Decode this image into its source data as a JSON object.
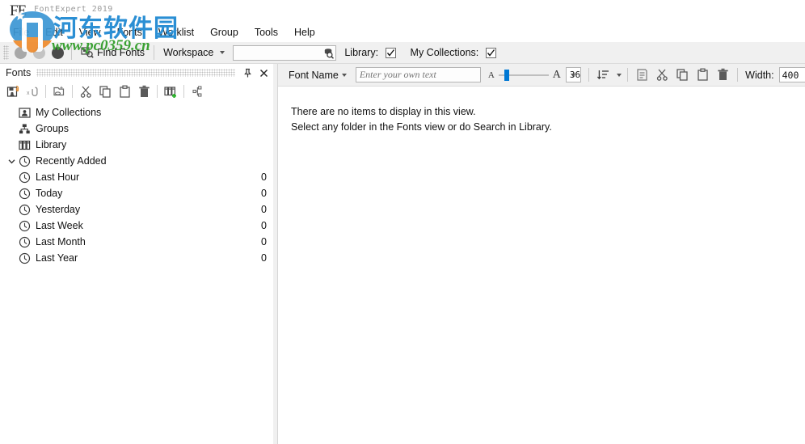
{
  "app": {
    "logo_text": "FE",
    "title": "FontExpert 2019"
  },
  "menubar": {
    "items": [
      {
        "label": "File"
      },
      {
        "label": "Edit"
      },
      {
        "label": "View"
      },
      {
        "label": "Fonts"
      },
      {
        "label": "Worklist"
      },
      {
        "label": "Group"
      },
      {
        "label": "Tools"
      },
      {
        "label": "Help"
      }
    ]
  },
  "toolbar": {
    "find_fonts_label": "Find Fonts",
    "workspace_label": "Workspace",
    "search_value": "",
    "search_placeholder": "",
    "search_icon": "search-library-icon",
    "library_label": "Library:",
    "library_checked": true,
    "my_collections_label": "My Collections:",
    "my_collections_checked": true,
    "circles": [
      {
        "name": "state-circle-1",
        "color": "#a8a8a8"
      },
      {
        "name": "state-circle-2",
        "color": "#c3c3c3"
      },
      {
        "name": "state-circle-3",
        "color": "#4a4a4a"
      }
    ]
  },
  "left_panel": {
    "title": "Fonts",
    "pin_icon": "pin-icon",
    "close_icon": "close-icon",
    "toolbar_icons": [
      {
        "name": "add-folder-icon"
      },
      {
        "name": "remove-link-icon"
      },
      {
        "name": "new-group-icon"
      },
      {
        "name": "cut-icon"
      },
      {
        "name": "copy-icon"
      },
      {
        "name": "paste-icon"
      },
      {
        "name": "delete-icon"
      },
      {
        "name": "add-library-icon"
      },
      {
        "name": "hierarchy-icon"
      }
    ],
    "tree": [
      {
        "label": "My Collections",
        "icon": "collections-icon",
        "indent": 0,
        "count": "",
        "expander": "none"
      },
      {
        "label": "Groups",
        "icon": "groups-icon",
        "indent": 0,
        "count": "",
        "expander": "none"
      },
      {
        "label": "Library",
        "icon": "library-icon",
        "indent": 0,
        "count": "",
        "expander": "none"
      },
      {
        "label": "Recently Added",
        "icon": "clock-icon",
        "indent": 0,
        "count": "",
        "expander": "expanded"
      },
      {
        "label": "Last Hour",
        "icon": "clock-icon",
        "indent": 1,
        "count": "0",
        "expander": "none"
      },
      {
        "label": "Today",
        "icon": "clock-icon",
        "indent": 1,
        "count": "0",
        "expander": "none"
      },
      {
        "label": "Yesterday",
        "icon": "clock-icon",
        "indent": 1,
        "count": "0",
        "expander": "none"
      },
      {
        "label": "Last Week",
        "icon": "clock-icon",
        "indent": 1,
        "count": "0",
        "expander": "none"
      },
      {
        "label": "Last Month",
        "icon": "clock-icon",
        "indent": 1,
        "count": "0",
        "expander": "none"
      },
      {
        "label": "Last Year",
        "icon": "clock-icon",
        "indent": 1,
        "count": "0",
        "expander": "none"
      }
    ]
  },
  "preview_toolbar": {
    "font_name_label": "Font Name",
    "sample_text_value": "",
    "sample_text_placeholder": "Enter your own text",
    "small_a": "A",
    "large_a": "A",
    "size_value": "36",
    "slider_position_pct": 12,
    "icons": [
      {
        "name": "sort-icon"
      },
      {
        "name": "sort-dropdown-caret"
      },
      {
        "name": "properties-icon"
      },
      {
        "name": "cut-icon"
      },
      {
        "name": "copy-icon"
      },
      {
        "name": "paste-icon"
      },
      {
        "name": "delete-icon"
      }
    ],
    "width_label": "Width:",
    "width_value": "400"
  },
  "content": {
    "empty_line_1": "There are no items to display in this view.",
    "empty_line_2": "Select any folder in the Fonts view or do Search in Library."
  },
  "watermark": {
    "cn_text": "河东软件园",
    "url_text": "www.pc0359.cn"
  },
  "colors": {
    "accent_blue": "#0078d4",
    "toolbar_bg": "#f0f0f0",
    "watermark_blue": "#2b8fd4",
    "watermark_green": "#3aa133",
    "watermark_orange": "#ef8b2c"
  }
}
